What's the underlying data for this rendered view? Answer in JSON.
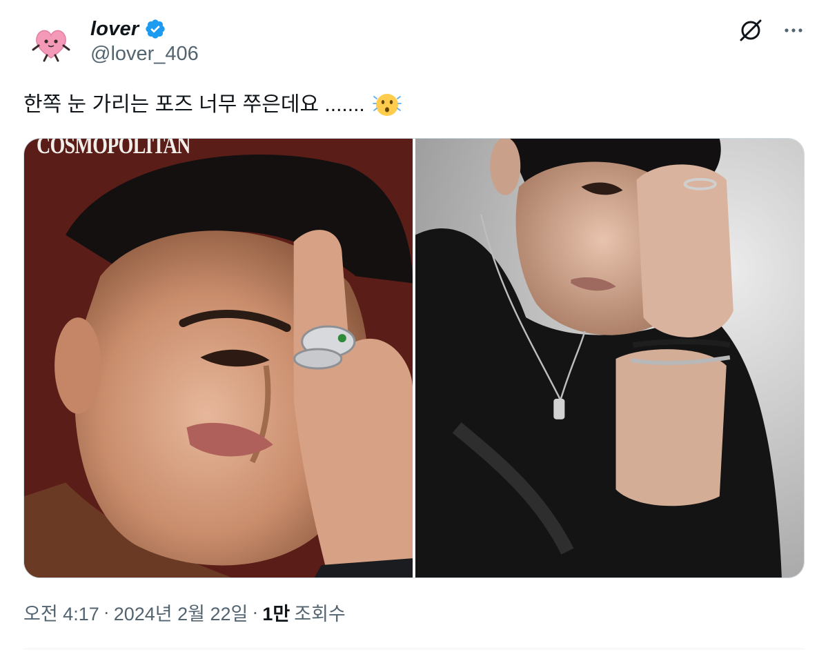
{
  "author": {
    "display_name": "lover",
    "handle": "@lover_406",
    "avatar_icon": "pink-heart-plush-avatar",
    "verified": true,
    "verified_color": "#1d9bf0"
  },
  "actions": {
    "grok_icon": "grok-icon",
    "more_icon": "more-horizontal-icon"
  },
  "tweet": {
    "text": "한쪽 눈 가리는 포즈 너무 쭈은데요 .......",
    "emoji": "😯"
  },
  "media": {
    "photos": [
      {
        "name": "photo-left",
        "overlay_text": "COSMOPOLITAN",
        "background": "#5a1d17"
      },
      {
        "name": "photo-right",
        "background": "#cfcfcf"
      }
    ]
  },
  "meta": {
    "time": "오전 4:17",
    "separator1": "·",
    "date": "2024년 2월 22일",
    "separator2": "·",
    "views_count": "1만",
    "views_label": "조회수"
  },
  "colors": {
    "text_primary": "#0f1419",
    "text_secondary": "#536471",
    "border": "#cfd9de"
  }
}
